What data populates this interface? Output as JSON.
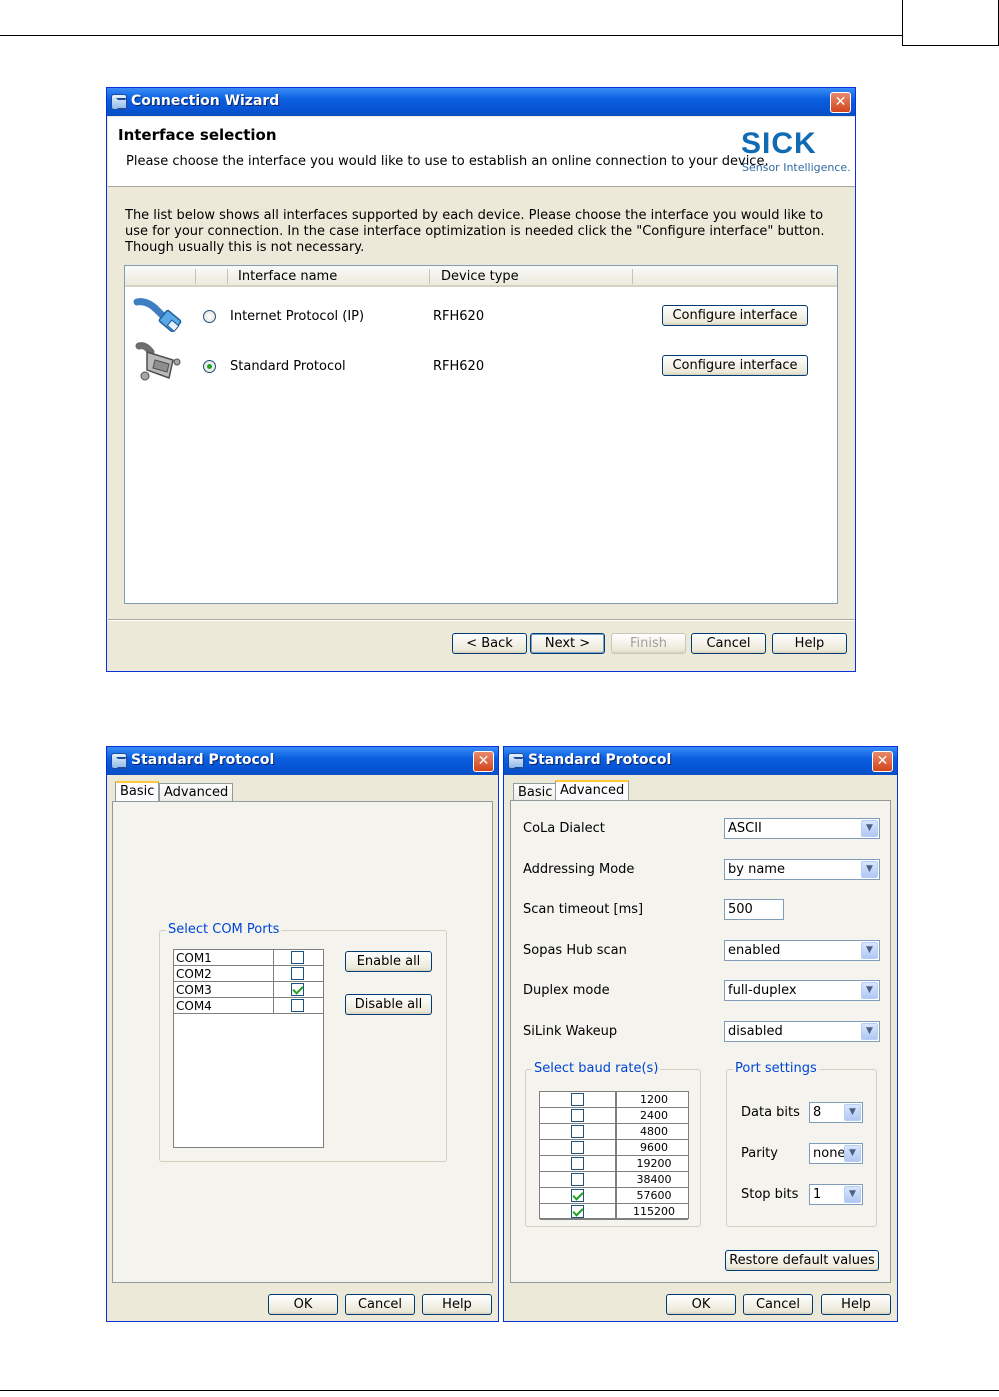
{
  "wizard": {
    "title": "Connection Wizard",
    "header_title": "Interface selection",
    "header_subtitle": "Please choose the interface you would like to use to establish an online connection to your device.",
    "logo_text": "SICK",
    "logo_tagline": "Sensor Intelligence.",
    "description": "The list below shows all interfaces supported by each device. Please choose the interface you would like to use for your connection. In the case interface optimization is needed click the \"Configure interface\" button. Though usually this is not necessary.",
    "columns": [
      "Interface name",
      "Device type"
    ],
    "rows": [
      {
        "name": "Internet Protocol (IP)",
        "device": "RFH620",
        "selected": false,
        "button": "Configure interface",
        "icon": "ethernet-cable-icon"
      },
      {
        "name": "Standard Protocol",
        "device": "RFH620",
        "selected": true,
        "button": "Configure interface",
        "icon": "serial-connector-icon"
      }
    ],
    "buttons": {
      "back": "< Back",
      "next": "Next >",
      "finish": "Finish",
      "cancel": "Cancel",
      "help": "Help"
    }
  },
  "basic_dialog": {
    "title": "Standard Protocol",
    "tabs": [
      "Basic",
      "Advanced"
    ],
    "active_tab": "Basic",
    "com_group_label": "Select COM Ports",
    "com_ports": [
      {
        "name": "COM1",
        "checked": false
      },
      {
        "name": "COM2",
        "checked": false
      },
      {
        "name": "COM3",
        "checked": true
      },
      {
        "name": "COM4",
        "checked": false
      }
    ],
    "enable_all": "Enable all",
    "disable_all": "Disable all",
    "buttons": {
      "ok": "OK",
      "cancel": "Cancel",
      "help": "Help"
    }
  },
  "advanced_dialog": {
    "title": "Standard Protocol",
    "tabs": [
      "Basic",
      "Advanced"
    ],
    "active_tab": "Advanced",
    "fields": [
      {
        "label": "CoLa Dialect",
        "value": "ASCII",
        "type": "combo"
      },
      {
        "label": "Addressing Mode",
        "value": "by name",
        "type": "combo"
      },
      {
        "label": "Scan timeout [ms]",
        "value": "500",
        "type": "text"
      },
      {
        "label": "Sopas Hub scan",
        "value": "enabled",
        "type": "combo"
      },
      {
        "label": "Duplex mode",
        "value": "full-duplex",
        "type": "combo"
      },
      {
        "label": "SiLink Wakeup",
        "value": "disabled",
        "type": "combo"
      }
    ],
    "baud_group_label": "Select baud rate(s)",
    "baud_rates": [
      {
        "rate": "1200",
        "checked": false
      },
      {
        "rate": "2400",
        "checked": false
      },
      {
        "rate": "4800",
        "checked": false
      },
      {
        "rate": "9600",
        "checked": false
      },
      {
        "rate": "19200",
        "checked": false
      },
      {
        "rate": "38400",
        "checked": false
      },
      {
        "rate": "57600",
        "checked": true
      },
      {
        "rate": "115200",
        "checked": true
      }
    ],
    "port_group_label": "Port settings",
    "port_settings": [
      {
        "label": "Data bits",
        "value": "8"
      },
      {
        "label": "Parity",
        "value": "none"
      },
      {
        "label": "Stop bits",
        "value": "1"
      }
    ],
    "restore_defaults": "Restore default values",
    "buttons": {
      "ok": "OK",
      "cancel": "Cancel",
      "help": "Help"
    }
  }
}
